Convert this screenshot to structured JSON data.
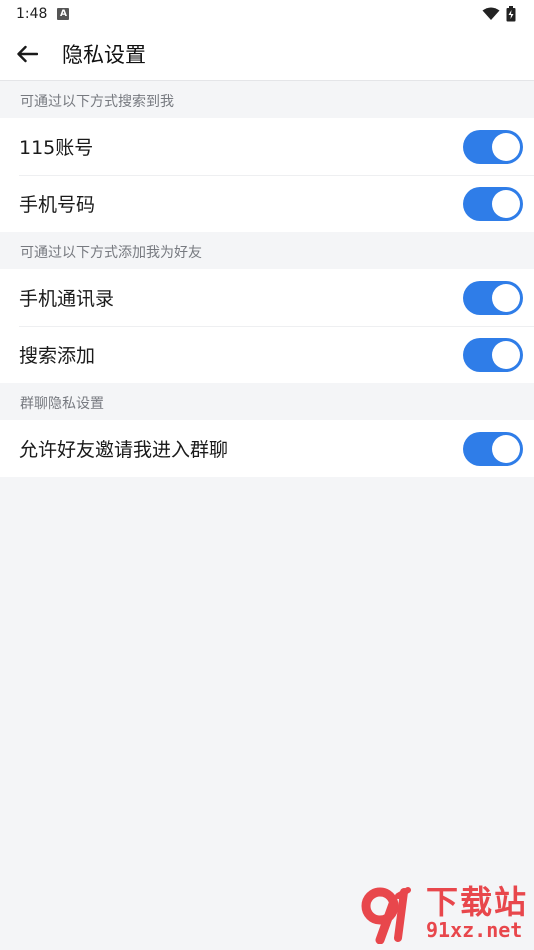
{
  "status_bar": {
    "time": "1:48",
    "app_icon_letter": "A"
  },
  "header": {
    "title": "隐私设置"
  },
  "sections": [
    {
      "title": "可通过以下方式搜索到我",
      "items": [
        {
          "label": "115账号",
          "on": true
        },
        {
          "label": "手机号码",
          "on": true
        }
      ]
    },
    {
      "title": "可通过以下方式添加我为好友",
      "items": [
        {
          "label": "手机通讯录",
          "on": true
        },
        {
          "label": "搜索添加",
          "on": true
        }
      ]
    },
    {
      "title": "群聊隐私设置",
      "items": [
        {
          "label": "允许好友邀请我进入群聊",
          "on": true
        }
      ]
    }
  ],
  "colors": {
    "toggle_on": "#2f7de8",
    "background": "#f4f5f7",
    "watermark": "#e8474c"
  },
  "watermark": {
    "title": "下载站",
    "url": "91xz.net"
  }
}
